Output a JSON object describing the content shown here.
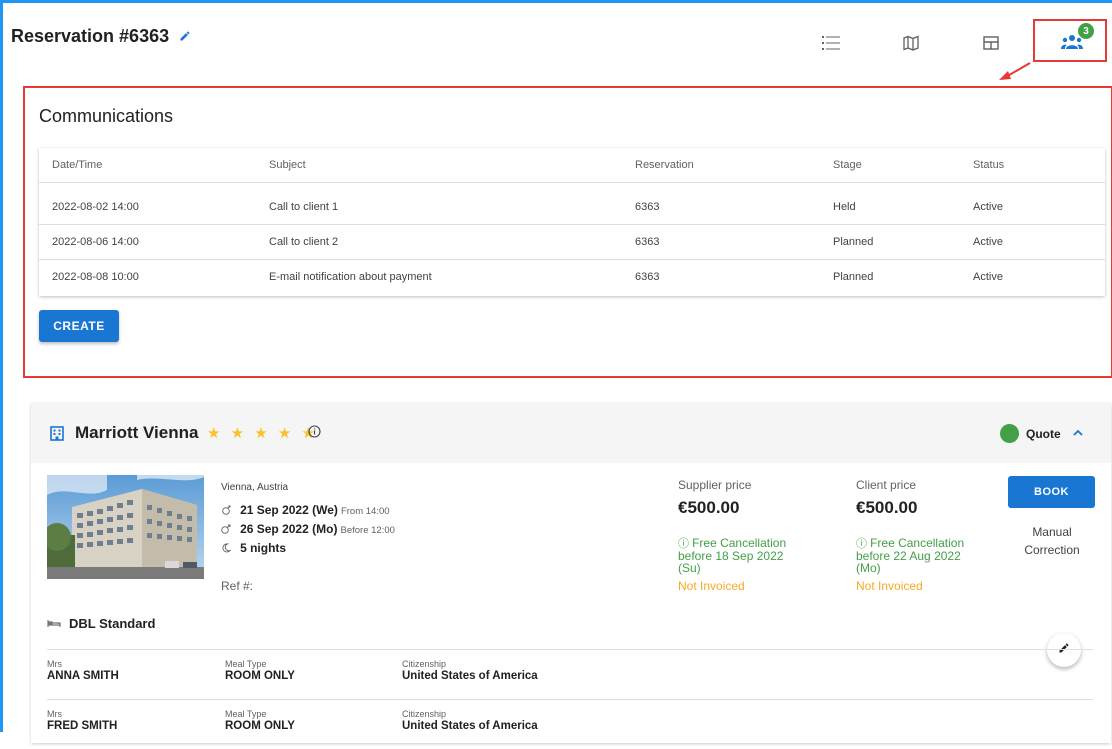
{
  "reservation": {
    "title": "Reservation #6363"
  },
  "toolbar": {
    "badge_count": "3"
  },
  "communications": {
    "title": "Communications",
    "columns": [
      "Date/Time",
      "Subject",
      "Reservation",
      "Stage",
      "Status"
    ],
    "rows": [
      [
        "2022-08-02 14:00",
        "Call to client 1",
        "6363",
        "Held",
        "Active"
      ],
      [
        "2022-08-06 14:00",
        "Call to client 2",
        "6363",
        "Planned",
        "Active"
      ],
      [
        "2022-08-08 10:00",
        "E-mail notification about payment",
        "6363",
        "Planned",
        "Active"
      ]
    ],
    "create_label": "CREATE"
  },
  "hotel": {
    "name": "Marriott Vienna",
    "stars": "★ ★ ★ ★ ★",
    "status_label": "Quote",
    "location": "Vienna, Austria",
    "checkin": "21 Sep 2022 (We)",
    "checkin_note": "From 14:00",
    "checkout": "26 Sep 2022 (Mo)",
    "checkout_note": "Before 12:00",
    "nights": "5 nights",
    "ref": "Ref #:",
    "supplier_price_label": "Supplier price",
    "supplier_price": "€500.00",
    "supplier_cancel_1": "Free Cancellation",
    "supplier_cancel_2": "before 18 Sep 2022",
    "supplier_cancel_3": "(Su)",
    "supplier_invoice": "Not Invoiced",
    "client_price_label": "Client price",
    "client_price": "€500.00",
    "client_cancel_1": "Free Cancellation",
    "client_cancel_2": "before 22 Aug 2022",
    "client_cancel_3": "(Mo)",
    "client_invoice": "Not Invoiced",
    "book_label": "BOOK",
    "manual_label_1": "Manual",
    "manual_label_2": "Correction",
    "room_type": "DBL Standard",
    "guests": [
      {
        "title": "Mrs",
        "name": "ANNA SMITH",
        "meal_label": "Meal Type",
        "meal": "ROOM ONLY",
        "cit_label": "Citizenship",
        "citizenship": "United States of America"
      },
      {
        "title": "Mrs",
        "name": "FRED SMITH",
        "meal_label": "Meal Type",
        "meal": "ROOM ONLY",
        "cit_label": "Citizenship",
        "citizenship": "United States of America"
      }
    ]
  },
  "colors": {
    "primary": "#1976d2",
    "highlight": "#e53935",
    "status_green": "#43a047",
    "star": "#fbc02d",
    "invoice": "#f9a825"
  }
}
